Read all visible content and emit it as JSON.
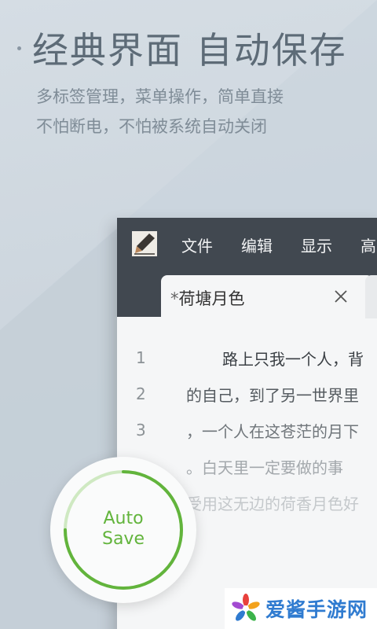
{
  "headline": {
    "title": "经典界面 自动保存"
  },
  "subtitle": {
    "line1": "多标签管理，菜单操作，简单直接",
    "line2": "不怕断电，不怕被系统自动关闭"
  },
  "app": {
    "menu": [
      "文件",
      "编辑",
      "显示",
      "高"
    ],
    "tab": {
      "modified_marker": "*",
      "title": "荷塘月色"
    },
    "editor": {
      "line_numbers": [
        "1",
        "2",
        "3"
      ],
      "lines": [
        "路上只我一个人，背",
        "的自己，到了另一世界里",
        "，一个人在这苍茫的月下",
        "。白天里一定要做的事",
        "受用这无边的荷香月色好"
      ]
    }
  },
  "autosave": {
    "line1": "Auto",
    "line2": "Save",
    "progress": 0.75,
    "color": "#62b43c"
  },
  "watermark": {
    "text": "爱酱手游网"
  }
}
